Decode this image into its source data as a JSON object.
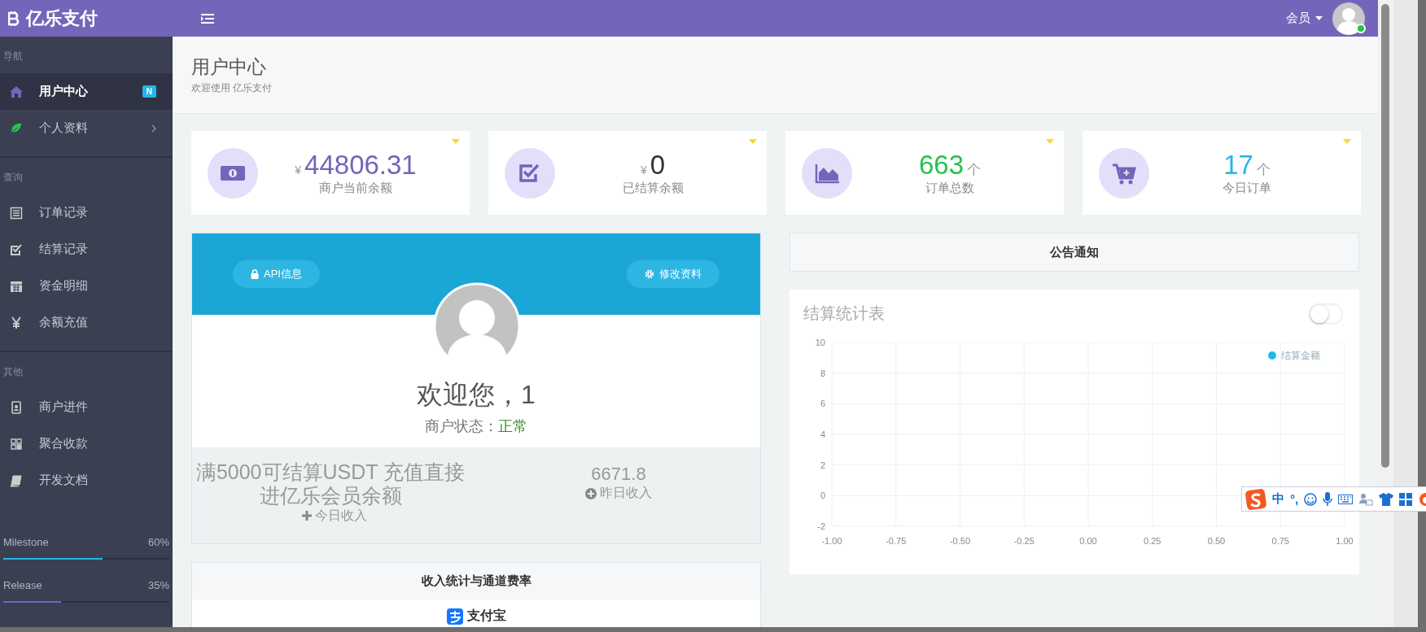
{
  "brand": {
    "title": "亿乐支付"
  },
  "topbar": {
    "user_menu": "会员",
    "online": true
  },
  "sidebar": {
    "sections": [
      {
        "heading": "导航",
        "items": [
          {
            "label": "用户中心",
            "selected": true,
            "badge": "N",
            "expandable": false
          },
          {
            "label": "个人资料",
            "selected": false,
            "expandable": true
          }
        ]
      },
      {
        "heading": "查询",
        "items": [
          {
            "label": "订单记录",
            "selected": false,
            "expandable": false
          },
          {
            "label": "结算记录",
            "selected": false,
            "expandable": false
          },
          {
            "label": "资金明细",
            "selected": false,
            "expandable": false
          },
          {
            "label": "余额充值",
            "selected": false,
            "expandable": false
          }
        ]
      },
      {
        "heading": "其他",
        "items": [
          {
            "label": "商户进件",
            "selected": false,
            "expandable": false
          },
          {
            "label": "聚合收款",
            "selected": false,
            "expandable": false
          },
          {
            "label": "开发文档",
            "selected": false,
            "expandable": false
          }
        ]
      }
    ],
    "progress": [
      {
        "label": "Milestone",
        "value": "60%",
        "level": 0.6,
        "color": "#23b7e5"
      },
      {
        "label": "Release",
        "value": "35%",
        "level": 0.35,
        "color": "#7266ba"
      }
    ]
  },
  "page_header": {
    "title": "用户中心",
    "subtitle": "欢迎使用 亿乐支付"
  },
  "stats": [
    {
      "currency": "¥",
      "value": "44806.31",
      "label": "商户当前余额",
      "color": "#7266ba"
    },
    {
      "currency": "¥",
      "value": "0",
      "label": "已结算余额",
      "color": "#333333"
    },
    {
      "value": "663",
      "unit": "个",
      "label": "订单总数",
      "color": "#27c24c"
    },
    {
      "value": "17",
      "unit": "个",
      "label": "今日订单",
      "color": "#23b7e5"
    }
  ],
  "profile": {
    "buttons": [
      "API信息",
      "修改资料"
    ],
    "greeting": "欢迎您，1",
    "status_label": "商户状态：",
    "status": "正常"
  },
  "income": {
    "today_note": "满5000可结算USDT 充值直接进亿乐会员余额",
    "today_label": "今日收入",
    "yesterday_value": "6671.8",
    "yesterday_label": "昨日收入"
  },
  "channel_card": {
    "title": "收入统计与通道费率",
    "channels": [
      {
        "name": "支付宝"
      }
    ]
  },
  "notice": {
    "title": "公告通知"
  },
  "chart_panel": {
    "title": "结算统计表",
    "toggle": {
      "on": false
    },
    "chart_data": {
      "type": "line",
      "grid": true,
      "series": [
        {
          "name": "结算金额",
          "color": "#23b7e5",
          "values": [
            null,
            null,
            null,
            null,
            null,
            null,
            null,
            null,
            null
          ]
        }
      ],
      "ylim": [
        -2,
        10
      ],
      "categories": [
        "-1.00",
        "-0.75",
        "-0.50",
        "-0.25",
        "0.00",
        "0.25",
        "0.50",
        "0.75",
        "1.00"
      ],
      "yticks": [
        -2,
        0,
        2,
        4,
        6,
        8,
        10
      ]
    }
  },
  "ime": {
    "mode": "中",
    "punct": "°,"
  }
}
